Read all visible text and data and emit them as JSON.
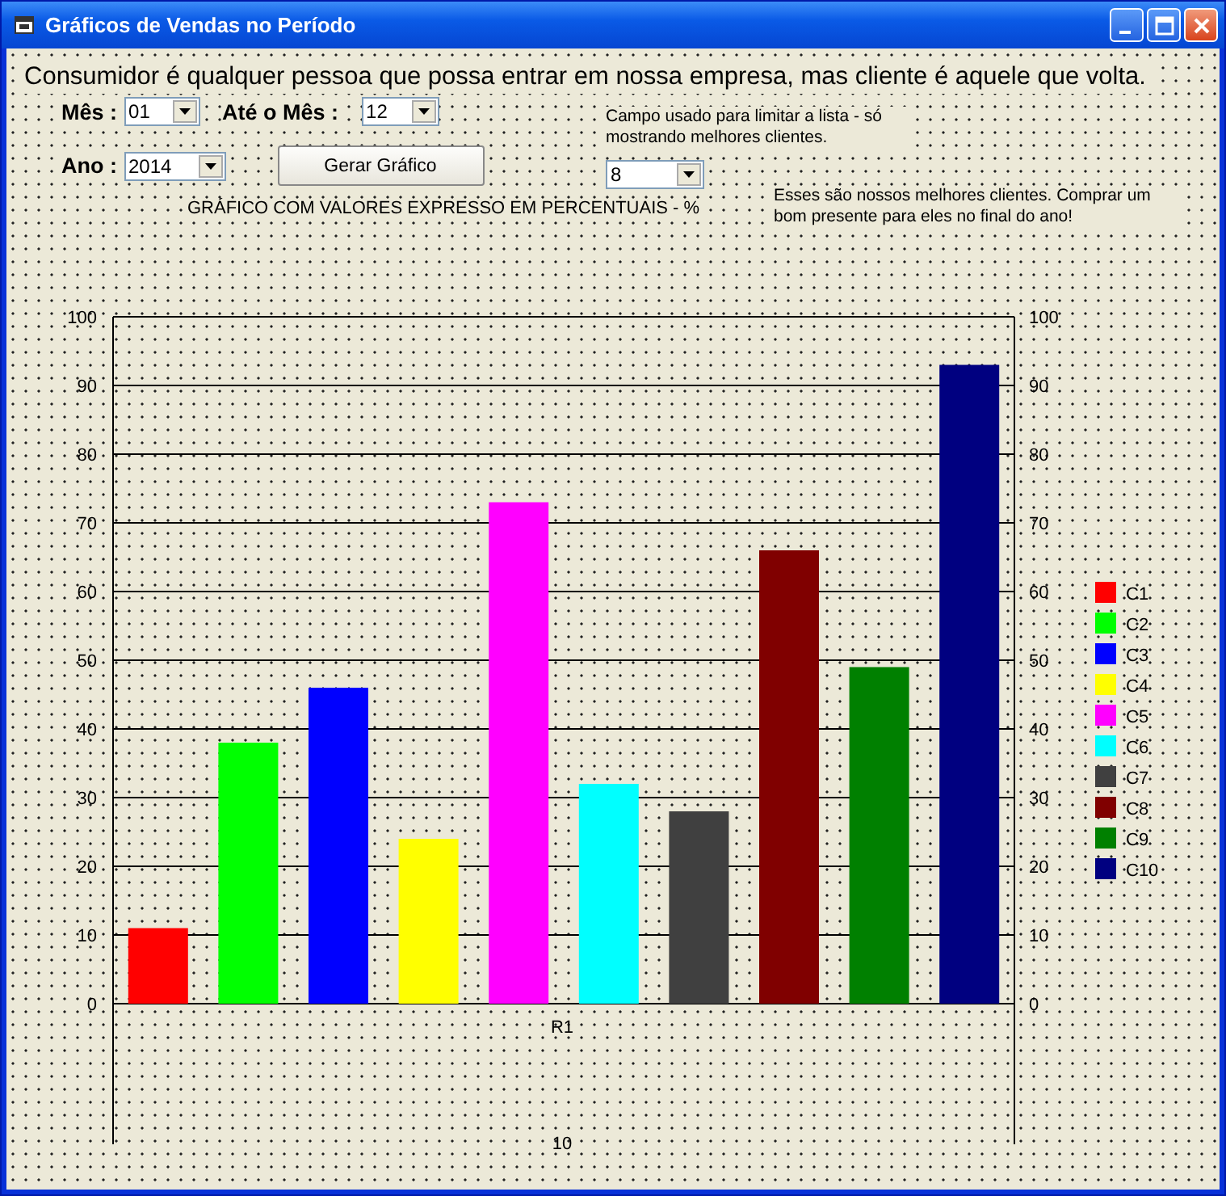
{
  "window": {
    "title": "Gráficos de Vendas no Período"
  },
  "headline": "Consumidor é qualquer pessoa que possa entrar em nossa empresa, mas cliente é aquele que volta.",
  "month_from": {
    "label": "Mês :",
    "value": "01"
  },
  "month_to": {
    "label": "Até o Mês :",
    "value": "12"
  },
  "year": {
    "label": "Ano :",
    "value": "2014"
  },
  "generate_button": "Gerar Gráfico",
  "chart_caption": "GRÁFICO COM VALORES EXPRESSO EM PERCENTUAIS - %",
  "limit_hint": "Campo usado para limitar a lista - só mostrando melhores clientes.",
  "limit": {
    "value": "8"
  },
  "best_clients_note": "Esses são nossos melhores clientes. Comprar um bom presente para eles no final do ano!",
  "right_axis": {
    "ticks": [
      "100",
      "90",
      "80",
      "70",
      "60",
      "50",
      "40",
      "30",
      "20",
      "10",
      "0"
    ]
  },
  "chart_data": {
    "type": "bar",
    "categories": [
      "R1"
    ],
    "xlabel": "10",
    "ylim": [
      0,
      100
    ],
    "yticks": [
      0,
      10,
      20,
      30,
      40,
      50,
      60,
      70,
      80,
      90,
      100
    ],
    "grid": true,
    "legend": true,
    "series": [
      {
        "name": "C1",
        "color": "#ff0000",
        "values": [
          11
        ]
      },
      {
        "name": "C2",
        "color": "#00ff00",
        "values": [
          38
        ]
      },
      {
        "name": "C3",
        "color": "#0000ff",
        "values": [
          46
        ]
      },
      {
        "name": "C4",
        "color": "#ffff00",
        "values": [
          24
        ]
      },
      {
        "name": "C5",
        "color": "#ff00ff",
        "values": [
          73
        ]
      },
      {
        "name": "C6",
        "color": "#00ffff",
        "values": [
          32
        ]
      },
      {
        "name": "C7",
        "color": "#404040",
        "values": [
          28
        ]
      },
      {
        "name": "C8",
        "color": "#800000",
        "values": [
          66
        ]
      },
      {
        "name": "C9",
        "color": "#008000",
        "values": [
          49
        ]
      },
      {
        "name": "C10",
        "color": "#000080",
        "values": [
          93
        ]
      }
    ]
  }
}
